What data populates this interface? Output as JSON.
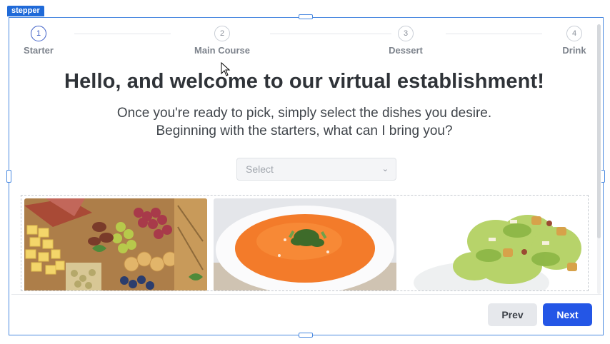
{
  "component_tag": "stepper",
  "stepper": {
    "steps": [
      {
        "number": "1",
        "label": "Starter",
        "active": true
      },
      {
        "number": "2",
        "label": "Main Course",
        "active": false
      },
      {
        "number": "3",
        "label": "Dessert",
        "active": false
      },
      {
        "number": "4",
        "label": "Drink",
        "active": false
      }
    ]
  },
  "content": {
    "heading": "Hello, and welcome to our virtual establishment!",
    "subtext_line1": "Once you're ready to pick, simply select the dishes you desire.",
    "subtext_line2": "Beginning with the starters, what can I bring you?"
  },
  "select": {
    "placeholder": "Select",
    "icon": "chevron-down-icon"
  },
  "gallery": {
    "items": [
      {
        "name": "charcuterie-board-image"
      },
      {
        "name": "tomato-soup-image"
      },
      {
        "name": "caesar-salad-image"
      }
    ]
  },
  "footer": {
    "prev_label": "Prev",
    "next_label": "Next"
  },
  "colors": {
    "accent": "#2456e6",
    "frame": "#4b8ae0",
    "active_step": "#3b5cc6"
  }
}
